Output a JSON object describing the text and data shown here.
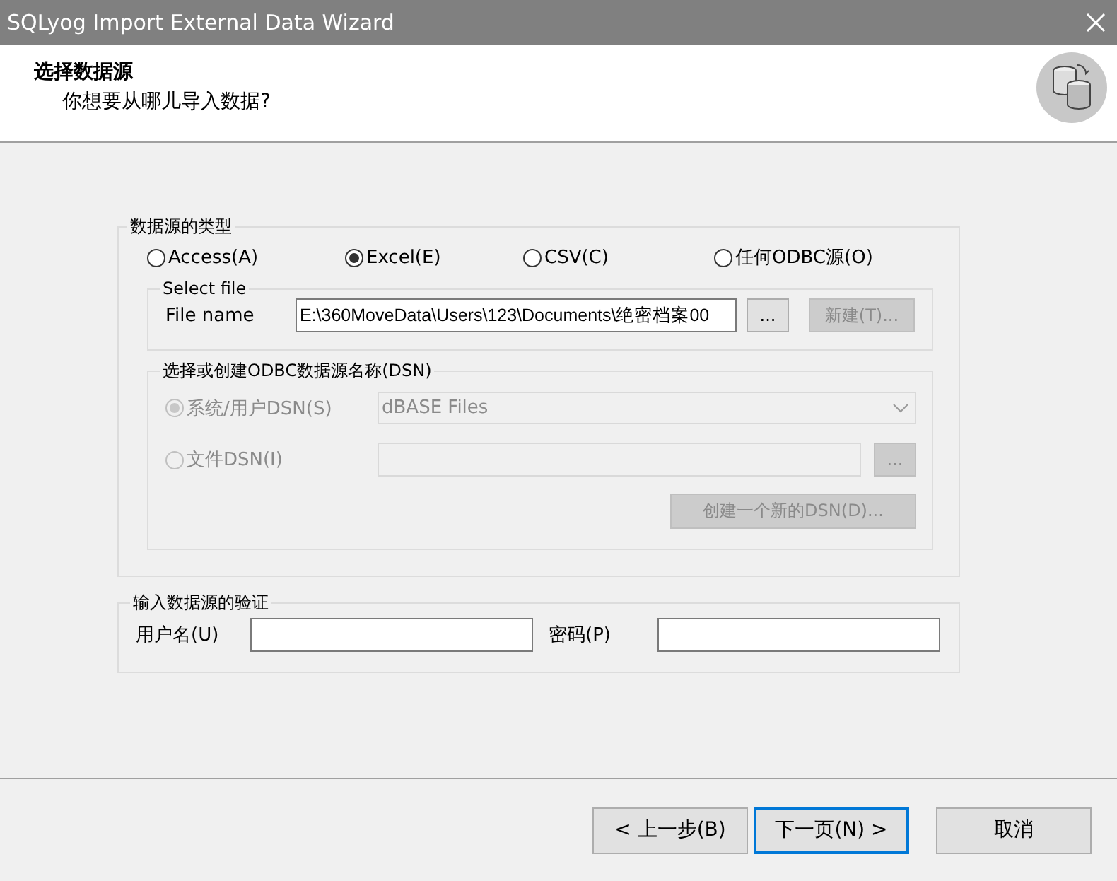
{
  "window": {
    "title": "SQLyog Import External Data Wizard"
  },
  "header": {
    "title": "选择数据源",
    "subtitle": "你想要从哪儿导入数据?"
  },
  "source_type": {
    "label": "数据源的类型",
    "options": [
      {
        "label": "Access(A)",
        "selected": false
      },
      {
        "label": "Excel(E)",
        "selected": true
      },
      {
        "label": "CSV(C)",
        "selected": false
      },
      {
        "label": "任何ODBC源(O)",
        "selected": false
      }
    ]
  },
  "select_file": {
    "label": "Select file",
    "file_name_label": "File name",
    "file_name_value": "E:\\360MoveData\\Users\\123\\Documents\\绝密档案00",
    "browse_button": {
      "label": "...",
      "disabled": false
    },
    "new_button": {
      "label": "新建(T)...",
      "disabled": true
    }
  },
  "dsn": {
    "label": "选择或创建ODBC数据源名称(DSN)",
    "disabled": true,
    "system_dsn": {
      "label": "系统/用户DSN(S)",
      "selected": true,
      "value": "dBASE Files"
    },
    "file_dsn": {
      "label": "文件DSN(I)",
      "selected": false,
      "browse_label": "..."
    },
    "create_button": {
      "label": "创建一个新的DSN(D)..."
    }
  },
  "auth": {
    "label": "输入数据源的验证",
    "username_label": "用户名(U)",
    "password_label": "密码(P)"
  },
  "buttons": [
    {
      "label": "< 上一步(B)",
      "default": false
    },
    {
      "label": "下一页(N) >",
      "default": true
    },
    {
      "label": "取消",
      "default": false
    }
  ]
}
